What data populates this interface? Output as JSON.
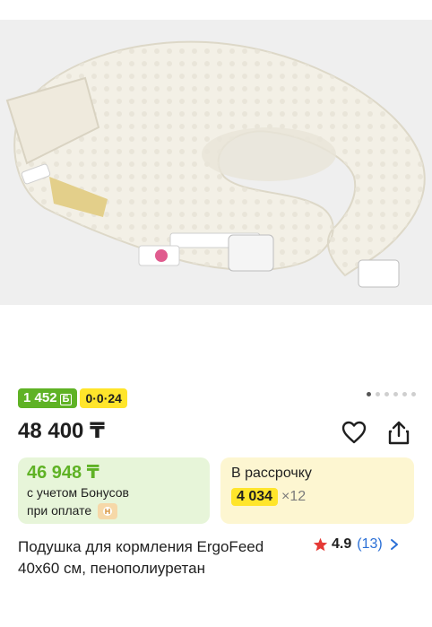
{
  "product": {
    "image_alt": "nursing-pillow-photo",
    "bonus_badge": "1 452",
    "bonus_currency": "Б",
    "timer_badge": "0·0·24",
    "price": "48 400 ₸",
    "bonus_card": {
      "price": "46 948 ₸",
      "line1": "с учетом Бонусов",
      "line2": "при оплате"
    },
    "installment": {
      "title": "В рассрочку",
      "amount": "4 034",
      "multiplier": "×12"
    },
    "title": "Подушка для кормления ErgoFeed 40x60 см, пенополиуретан",
    "rating": {
      "value": "4.9",
      "count": "(13)"
    },
    "gallery": {
      "total": 6,
      "active": 0
    }
  },
  "colors": {
    "bonus_green": "#5fb225",
    "timer_yellow": "#ffe52b",
    "link_blue": "#2a6fd6",
    "star_red": "#e53935"
  }
}
